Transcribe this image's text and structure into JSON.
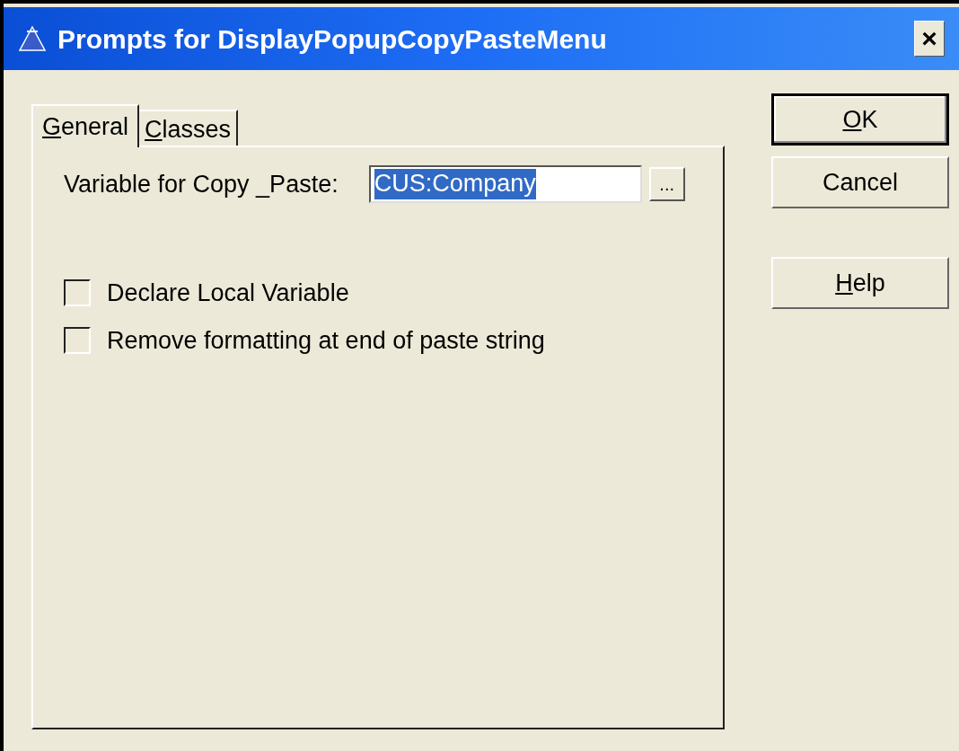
{
  "window": {
    "title": "Prompts for DisplayPopupCopyPasteMenu",
    "close": "×"
  },
  "tabs": [
    {
      "label": "General",
      "access_key_underlined": true,
      "selected": true
    },
    {
      "label": "Classes",
      "access_key_underlined": true,
      "selected": false
    }
  ],
  "variable_field": {
    "label": "Variable for Copy _Paste:",
    "value": "CUS:Company",
    "text_selected": true,
    "browse": "..."
  },
  "checkboxes": [
    {
      "label": "Declare Local Variable",
      "checked": false
    },
    {
      "label": "Remove formatting at end of paste string",
      "checked": false
    }
  ],
  "buttons": [
    {
      "label": "OK",
      "access_key_underlined": true,
      "default": true
    },
    {
      "label": "Cancel",
      "access_key_underlined": false,
      "default": false
    },
    {
      "label": "Help",
      "access_key_underlined": true,
      "default": false
    }
  ]
}
